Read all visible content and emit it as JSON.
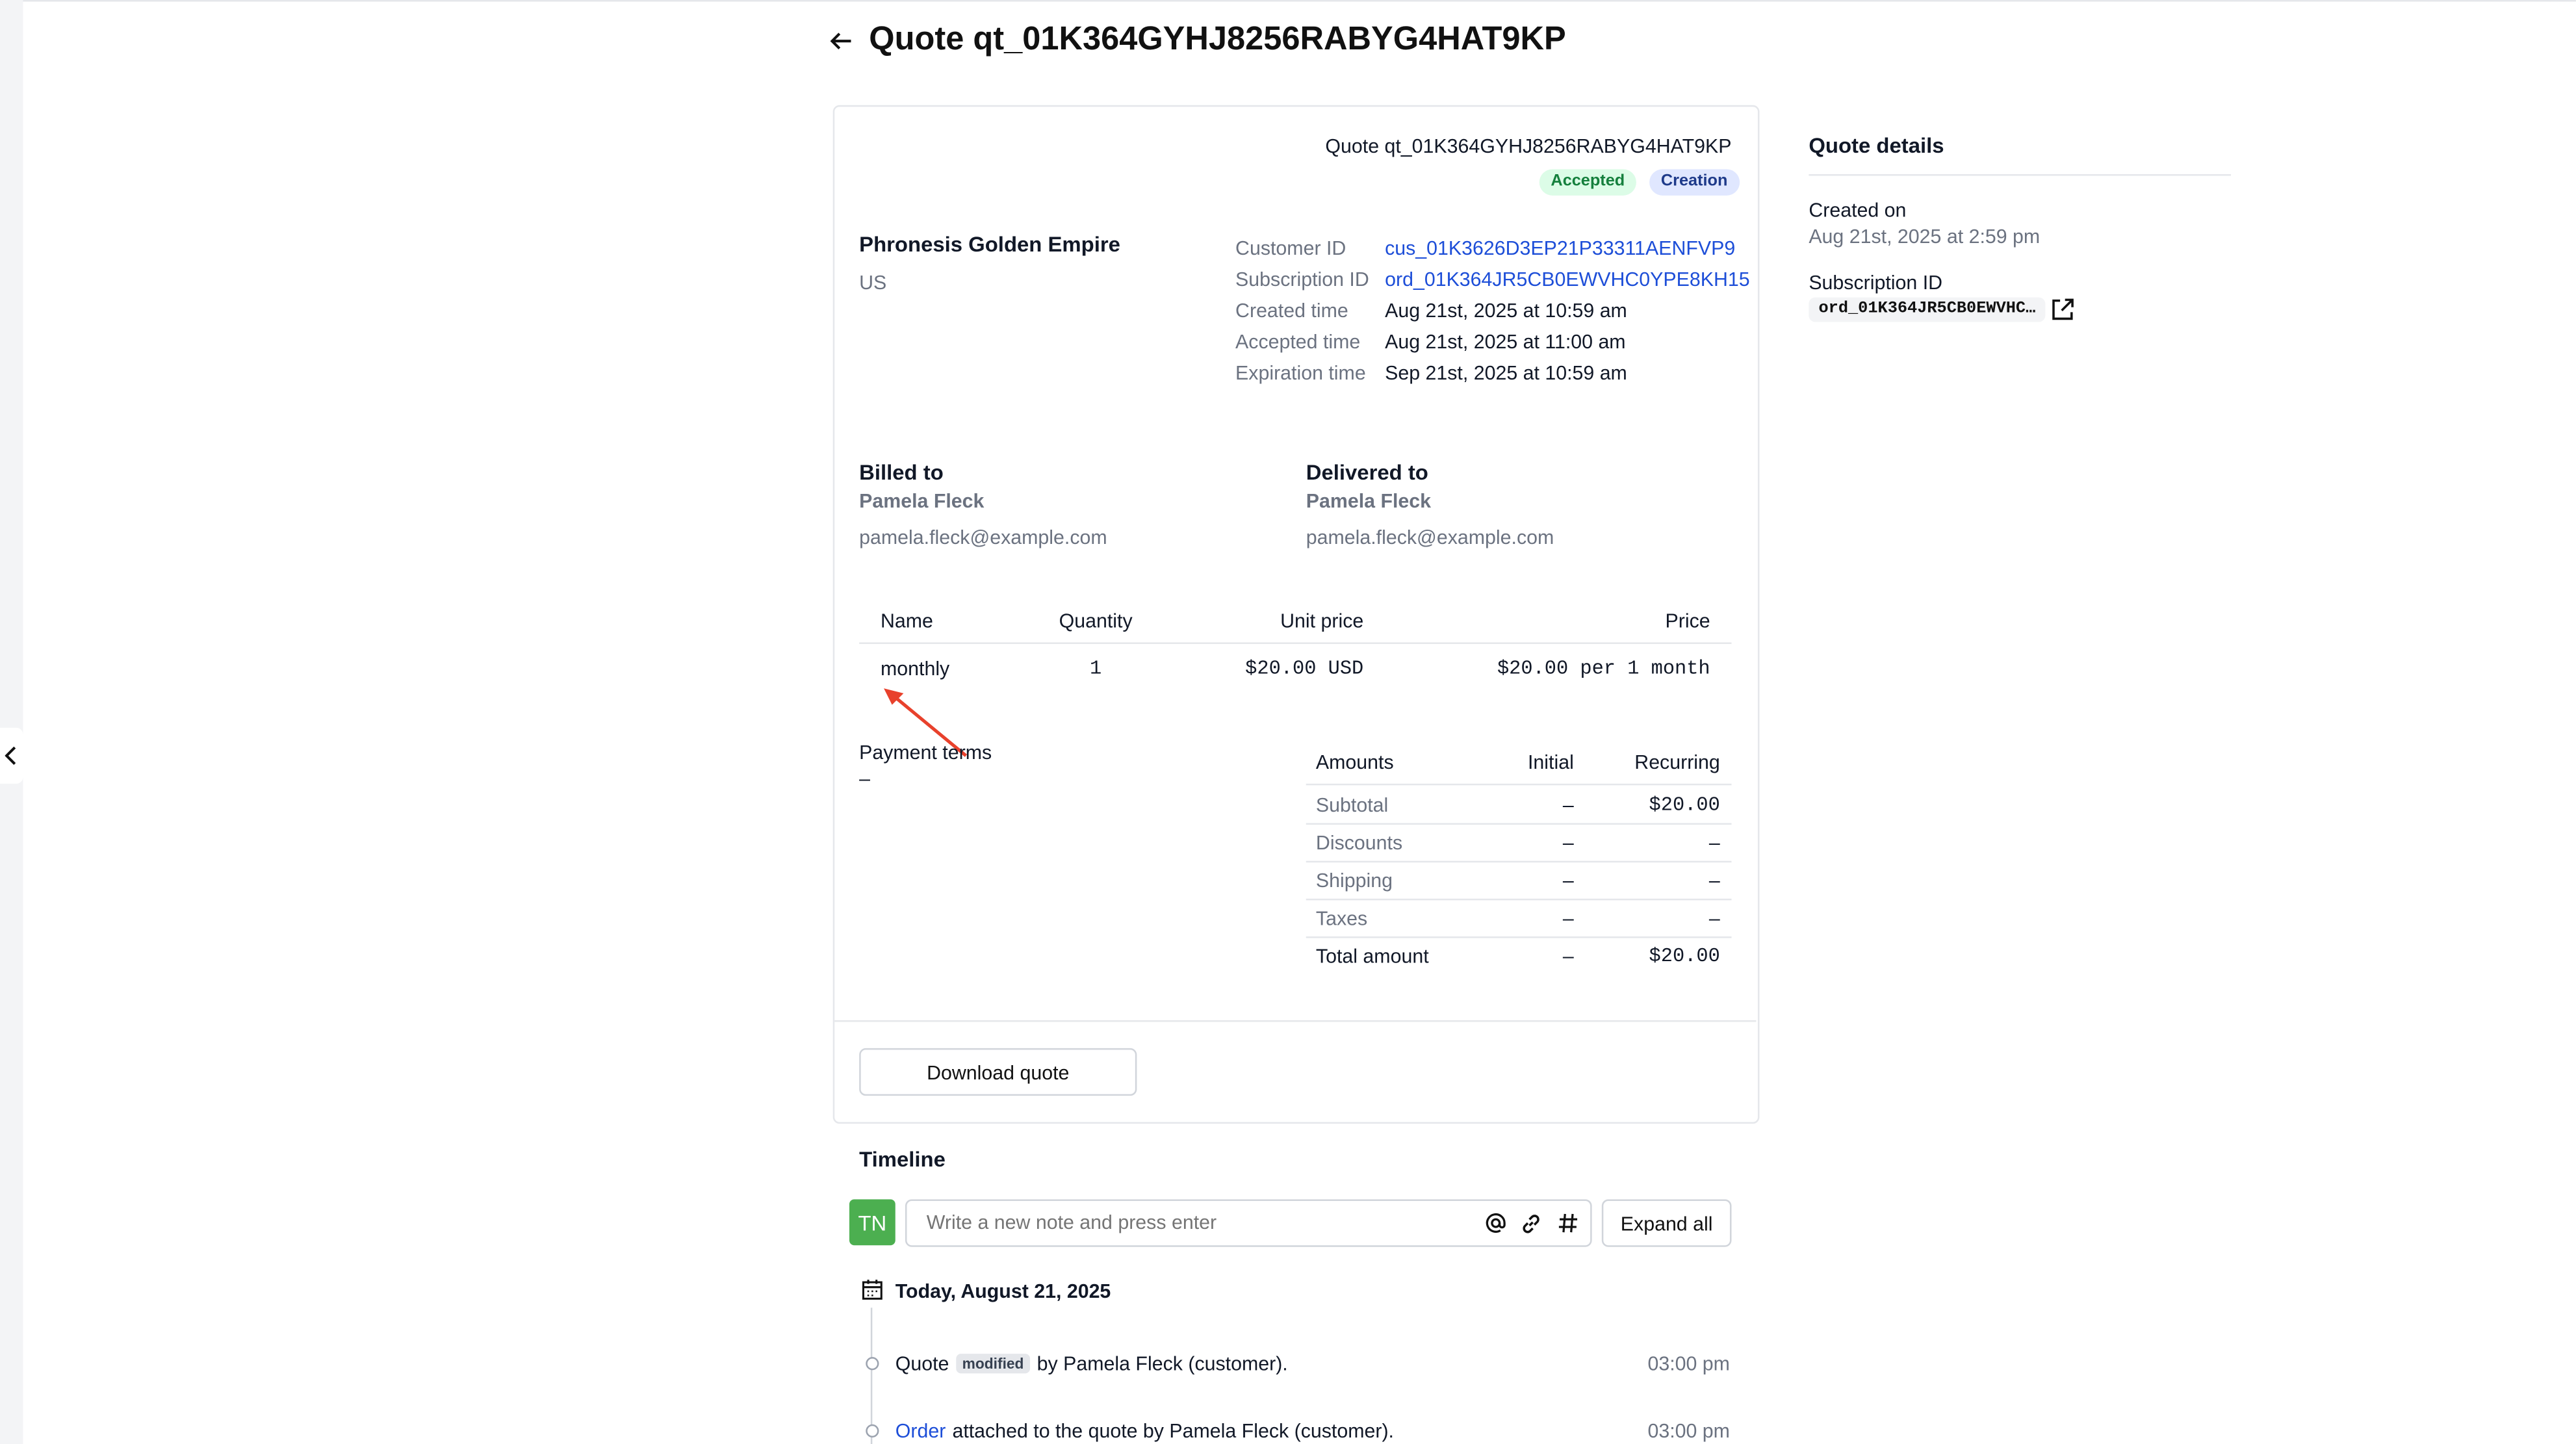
{
  "page": {
    "title": "Quote qt_01K364GYHJ8256RABYG4HAT9KP"
  },
  "quote": {
    "header_id": "Quote qt_01K364GYHJ8256RABYG4HAT9KP",
    "badges": [
      "Accepted",
      "Creation"
    ],
    "company": "Phronesis Golden Empire",
    "country": "US",
    "meta": {
      "customer_id_label": "Customer ID",
      "customer_id": "cus_01K3626D3EP21P33311AENFVP9",
      "subscription_id_label": "Subscription ID",
      "subscription_id": "ord_01K364JR5CB0EWVHC0YPE8KH15",
      "created_label": "Created time",
      "created": "Aug 21st, 2025 at 10:59 am",
      "accepted_label": "Accepted time",
      "accepted": "Aug 21st, 2025 at 11:00 am",
      "expiration_label": "Expiration time",
      "expiration": "Sep 21st, 2025 at 10:59 am"
    },
    "billed_to": {
      "heading": "Billed to",
      "name": "Pamela Fleck",
      "email": "pamela.fleck@example.com"
    },
    "delivered_to": {
      "heading": "Delivered to",
      "name": "Pamela Fleck",
      "email": "pamela.fleck@example.com"
    },
    "items_table": {
      "headers": [
        "Name",
        "Quantity",
        "Unit price",
        "Price"
      ],
      "rows": [
        [
          "monthly",
          "1",
          "$20.00 USD",
          "$20.00 per 1 month"
        ]
      ]
    },
    "payment_terms": {
      "label": "Payment terms",
      "value": "–"
    },
    "amounts": {
      "headers": [
        "Amounts",
        "Initial",
        "Recurring"
      ],
      "rows": [
        [
          "Subtotal",
          "–",
          "$20.00"
        ],
        [
          "Discounts",
          "–",
          "–"
        ],
        [
          "Shipping",
          "–",
          "–"
        ],
        [
          "Taxes",
          "–",
          "–"
        ],
        [
          "Total amount",
          "–",
          "$20.00"
        ]
      ]
    },
    "download_label": "Download quote"
  },
  "details_panel": {
    "heading": "Quote details",
    "created_on_label": "Created on",
    "created_on": "Aug 21st, 2025 at 2:59 pm",
    "subscription_label": "Subscription ID",
    "subscription_value": "ord_01K364JR5CB0EWVHC…"
  },
  "timeline": {
    "heading": "Timeline",
    "avatar_initials": "TN",
    "note_placeholder": "Write a new note and press enter",
    "expand_label": "Expand all",
    "date_heading": "Today, August 21, 2025",
    "events": [
      {
        "prefix": "Quote",
        "tag": "modified",
        "suffix": "by Pamela Fleck (customer).",
        "time": "03:00 pm"
      },
      {
        "link": "Order",
        "suffix": "attached to the quote by Pamela Fleck (customer).",
        "time": "03:00 pm"
      }
    ]
  },
  "colors": {
    "accent_link": "#1d4ed8",
    "avatar_green": "#4caf50",
    "annotation_arrow": "#e8412c"
  },
  "icons": [
    "arrow-left-icon",
    "chevron-left-icon",
    "external-link-icon",
    "at-sign-icon",
    "link-icon",
    "hash-icon",
    "calendar-icon"
  ]
}
